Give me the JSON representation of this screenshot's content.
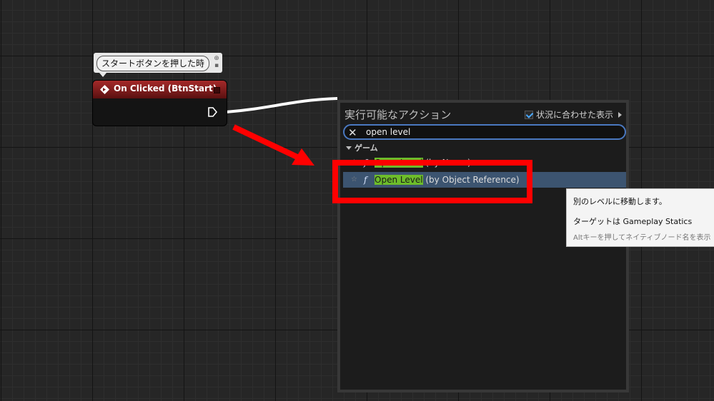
{
  "comment": {
    "text": "スタートボタンを押した時"
  },
  "event_node": {
    "title": "On Clicked (BtnStart)"
  },
  "action_menu": {
    "title": "実行可能なアクション",
    "context_sensitive_label": "状況に合わせた表示",
    "search_value": "open level",
    "category": "ゲーム",
    "items": [
      {
        "highlight": "Open Level",
        "rest": " (by Name)"
      },
      {
        "highlight": "Open Level",
        "rest": " (by Object Reference)"
      }
    ]
  },
  "tooltip": {
    "line1": "別のレベルに移動します。",
    "line2": "ターゲットは Gameplay Statics",
    "line3": "Altキーを押してネイティブノード名を表示"
  },
  "colors": {
    "annotation": "#ff0000",
    "node_header": "#a52a2a",
    "selection": "#3c5470",
    "search_highlight": "#6dbd2a"
  }
}
